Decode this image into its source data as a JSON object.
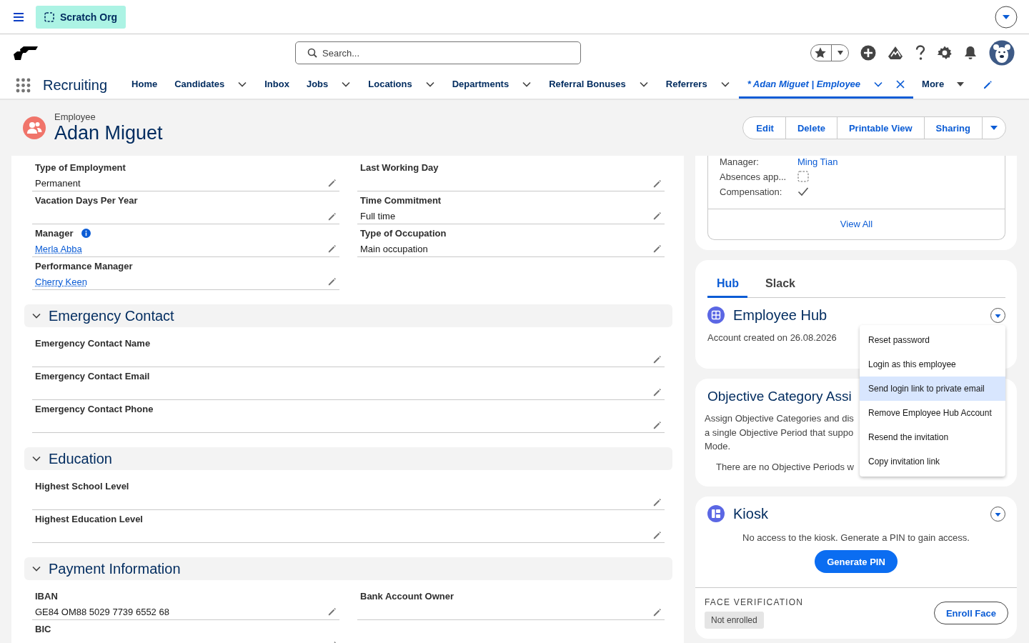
{
  "top_bar": {
    "org_label": "Scratch Org"
  },
  "search": {
    "placeholder": "Search..."
  },
  "app_name": "Recruiting",
  "nav_tabs": [
    {
      "label": "Home",
      "kind": "plain",
      "has_menu": false,
      "selected": false
    },
    {
      "label": "Candidates",
      "kind": "plain",
      "has_menu": true,
      "selected": false
    },
    {
      "label": "Inbox",
      "kind": "plain",
      "has_menu": false,
      "selected": false
    },
    {
      "label": "Jobs",
      "kind": "plain",
      "has_menu": true,
      "selected": false
    },
    {
      "label": "Locations",
      "kind": "plain",
      "has_menu": true,
      "selected": false
    },
    {
      "label": "Departments",
      "kind": "plain",
      "has_menu": true,
      "selected": false
    },
    {
      "label": "Referral Bonuses",
      "kind": "plain",
      "has_menu": true,
      "selected": false
    },
    {
      "label": "Referrers",
      "kind": "plain",
      "has_menu": true,
      "selected": false
    },
    {
      "label": "* Adan Miguet | Employee",
      "kind": "record",
      "has_menu": true,
      "selected": true
    },
    {
      "label": "More",
      "kind": "more",
      "has_menu": true,
      "selected": false
    }
  ],
  "record": {
    "type": "Employee",
    "name": "Adan Miguet"
  },
  "actions": [
    "Edit",
    "Delete",
    "Printable View",
    "Sharing"
  ],
  "details": {
    "columns": [
      [
        {
          "label": "Type of Employment",
          "value": "Permanent",
          "link": false,
          "info": false
        },
        {
          "label": "Vacation Days Per Year",
          "info": false
        },
        {
          "label": "Manager",
          "value": "Merla Abba",
          "link": true,
          "info": true
        },
        {
          "label": "Performance Manager",
          "value": "Cherry Keen",
          "link": true,
          "info": false
        }
      ],
      [
        {
          "label": "Last Working Day",
          "info": false
        },
        {
          "label": "Time Commitment",
          "value": "Full time",
          "link": false,
          "info": false
        },
        {
          "label": "Type of Occupation",
          "value": "Main occupation",
          "link": false,
          "info": false
        }
      ]
    ]
  },
  "sections": [
    {
      "title": "Emergency Contact",
      "expanded": true,
      "columns": [
        [
          {
            "label": "Emergency Contact Name",
            "info": false
          },
          {
            "label": "Emergency Contact Email",
            "info": false
          },
          {
            "label": "Emergency Contact Phone",
            "info": false
          }
        ]
      ]
    },
    {
      "title": "Education",
      "expanded": true,
      "columns": [
        [
          {
            "label": "Highest School Level",
            "info": false
          },
          {
            "label": "Highest Education Level",
            "info": false
          }
        ]
      ]
    },
    {
      "title": "Payment Information",
      "expanded": true,
      "columns": [
        [
          {
            "label": "IBAN",
            "value": "GE84 OM88 5029 7739 6552 68",
            "link": false,
            "info": false
          },
          {
            "label": "BIC",
            "info": false
          }
        ],
        [
          {
            "label": "Bank Account Owner",
            "info": false
          }
        ]
      ]
    }
  ],
  "related_card": {
    "rows": [
      {
        "label": "Manager:",
        "kind": "link",
        "value": "Ming Tian"
      },
      {
        "label": "Absences app...",
        "kind": "checkbox",
        "checked": false
      },
      {
        "label": "Compensation:",
        "kind": "checkbox",
        "checked": true
      }
    ],
    "view_all": "View All"
  },
  "hub_card": {
    "tabs": [
      {
        "label": "Hub",
        "selected": true
      },
      {
        "label": "Slack",
        "selected": false
      }
    ],
    "title": "Employee Hub",
    "text": "Account created on 26.08.2026",
    "menu": [
      {
        "label": "Reset password",
        "selected": false
      },
      {
        "label": "Login as this employee",
        "selected": false
      },
      {
        "label": "Send login link to private email",
        "selected": true
      },
      {
        "label": "Remove Employee Hub Account",
        "selected": false
      },
      {
        "label": "Resend the invitation",
        "selected": false
      },
      {
        "label": "Copy invitation link",
        "selected": false
      }
    ]
  },
  "objective_card": {
    "title": "Objective Category Assi",
    "description": [
      "Assign Objective Categories and dis",
      "a single Objective Period that suppo",
      "Mode."
    ],
    "empty_text": "There are no Objective Periods w"
  },
  "kiosk_card": {
    "title": "Kiosk",
    "text": "No access to the kiosk. Generate a PIN to gain access.",
    "button": "Generate PIN",
    "face_verification": {
      "heading": "FACE VERIFICATION",
      "status": "Not enrolled",
      "button": "Enroll Face"
    }
  }
}
